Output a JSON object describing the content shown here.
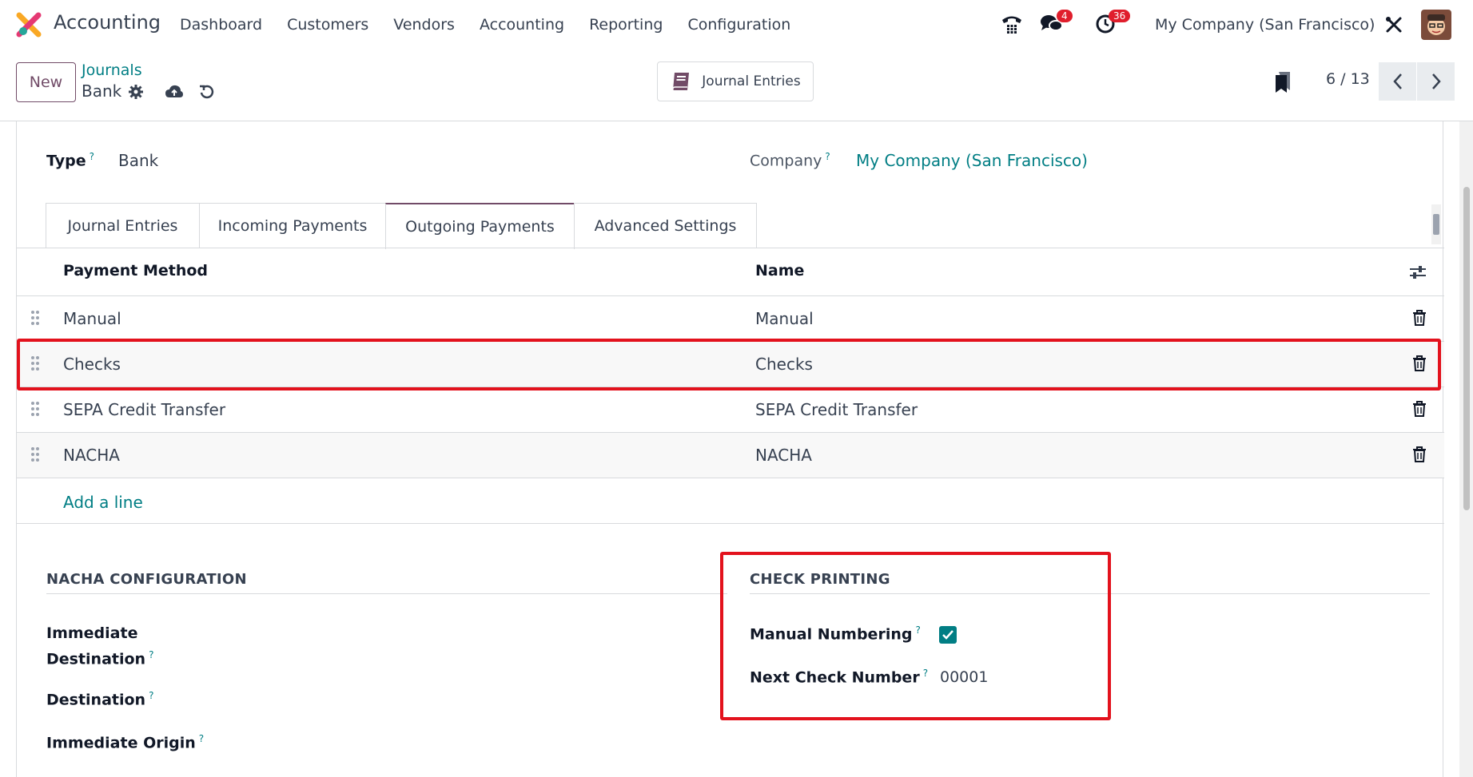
{
  "navbar": {
    "app_name": "Accounting",
    "menu": [
      "Dashboard",
      "Customers",
      "Vendors",
      "Accounting",
      "Reporting",
      "Configuration"
    ],
    "messages_count": "4",
    "activities_count": "36",
    "company": "My Company (San Francisco)"
  },
  "control": {
    "new_label": "New",
    "breadcrumb_parent": "Journals",
    "breadcrumb_current": "Bank",
    "smart_button_label": "Journal Entries",
    "pager": "6 / 13"
  },
  "form": {
    "type_label": "Type",
    "type_value": "Bank",
    "company_label": "Company",
    "company_value": "My Company (San Francisco)",
    "help_mark": "?",
    "tabs": [
      "Journal Entries",
      "Incoming Payments",
      "Outgoing Payments",
      "Advanced Settings"
    ],
    "active_tab": "Outgoing Payments",
    "table": {
      "headers": [
        "Payment Method",
        "Name"
      ],
      "rows": [
        {
          "method": "Manual",
          "name": "Manual"
        },
        {
          "method": "Checks",
          "name": "Checks"
        },
        {
          "method": "SEPA Credit Transfer",
          "name": "SEPA Credit Transfer"
        },
        {
          "method": "NACHA",
          "name": "NACHA"
        }
      ],
      "add_line": "Add a line"
    },
    "nacha": {
      "title": "NACHA CONFIGURATION",
      "immediate_destination_line1": "Immediate",
      "immediate_destination_line2": "Destination",
      "destination": "Destination",
      "immediate_origin": "Immediate Origin"
    },
    "check_printing": {
      "title": "CHECK PRINTING",
      "manual_numbering_label": "Manual Numbering",
      "manual_numbering_checked": true,
      "next_check_number_label": "Next Check Number",
      "next_check_number_value": "00001"
    }
  },
  "colors": {
    "brand": "#714b67",
    "link": "#017e84",
    "highlight": "#e3121d",
    "badge": "#e01e2c"
  }
}
